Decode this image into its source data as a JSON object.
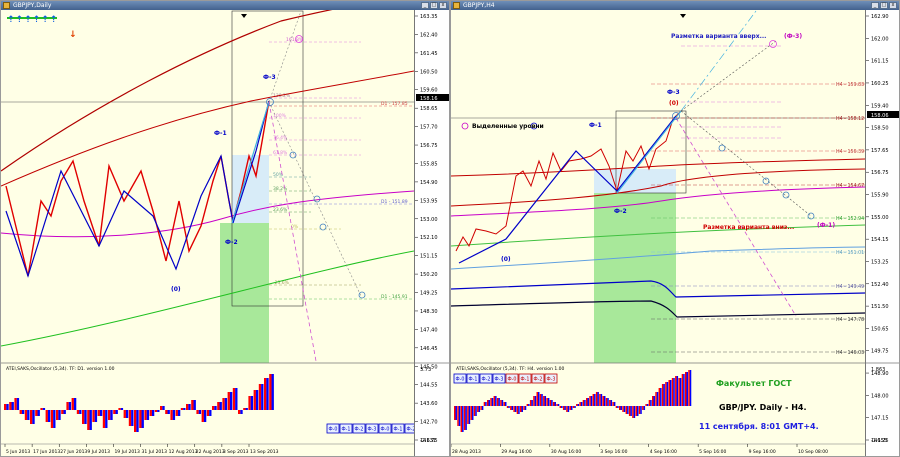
{
  "colors": {
    "chart_bg": "#ffffe6",
    "bull_line": "#0000c8",
    "bear_line": "#e00000",
    "accent_purple": "#c800c8",
    "green_zone": "#a8e89a",
    "osc_red": "#ff0000",
    "osc_blue": "#0000ff"
  },
  "left": {
    "title": "GBPJPY,Daily",
    "icons": [
      "arrow-up-icon",
      "arrow-up-icon",
      "arrow-up-icon",
      "arrow-up-icon",
      "arrow-up-icon",
      "arrow-up-icon"
    ],
    "red_arrow_icon": "arrow-down-icon",
    "price_labels": [
      "163.35",
      "162.40",
      "161.45",
      "160.50",
      "159.60",
      "158.65",
      "157.70",
      "156.75",
      "155.85",
      "154.90",
      "153.95",
      "153.00",
      "152.10",
      "151.15",
      "150.20",
      "149.25",
      "148.30",
      "147.40",
      "146.45",
      "145.50",
      "144.55",
      "143.60",
      "142.70",
      "141.75"
    ],
    "current_price_tag": "158.16",
    "osc_top": "3.73",
    "osc_bottom": "-2.631",
    "date_labels": [
      "5 Jun 2013",
      "17 Jun 2013",
      "27 Jun 2013",
      "9 Jul 2013",
      "19 Jul 2013",
      "31 Jul 2013",
      "12 Aug 2013",
      "22 Aug 2013",
      "3 Sep 2013",
      "13 Sep 2013"
    ],
    "osc_label": "ATEI,SAKS,Oscillator (5,34). TF: D1. version 1.00",
    "fib_labels": [
      "161.8%",
      "138.2%",
      "100%",
      "76.4%",
      "61.8%",
      "50%",
      "38.2%",
      "23.6%",
      "0%",
      "-23.6%"
    ],
    "level_tags": [
      "D1 - 157.85",
      "D1 - 151.89",
      "D1 - 145.91"
    ],
    "wave_labels": [
      "Ф-3",
      "Ф-1",
      "Ф-2",
      "(0)"
    ],
    "legend_buttons": [
      "Ф-0",
      "Ф-1",
      "Ф-2",
      "Ф-3",
      "Ф-0",
      "Ф-1",
      "Ф-2"
    ]
  },
  "right": {
    "title": "GBPJPY,H4",
    "price_labels": [
      "162.90",
      "162.00",
      "161.15",
      "160.25",
      "159.40",
      "158.50",
      "157.65",
      "156.75",
      "155.90",
      "155.00",
      "154.15",
      "153.25",
      "152.40",
      "151.50",
      "150.65",
      "149.75",
      "148.90",
      "148.00",
      "147.15",
      "146.25"
    ],
    "current_price_tag": "158.06",
    "osc_top": "1.863",
    "osc_bottom": "-1.155",
    "date_labels": [
      "28 Aug 2013",
      "29 Aug 16:00",
      "30 Aug 16:00",
      "3 Sep 16:00",
      "4 Sep 16:00",
      "5 Sep 16:00",
      "9 Sep 16:00",
      "10 Sep 08:00"
    ],
    "osc_label": "ATEI,SAKS,Oscillator (5,34). TF: H4. version 1.00",
    "level_tags": [
      "H4 - 159.83",
      "H4 - 158.12",
      "H4 - 156.39",
      "H4 - 154.67",
      "H4 - 152.94",
      "H4 - 151.01",
      "H4 - 149.49",
      "H4 - 147.78",
      "H4 - 146.03"
    ],
    "wave_labels": [
      "Ф-3",
      "(Ф-3)",
      "Ф-1",
      "Ф-2",
      "(0)",
      "(0)",
      "(Ф-1)"
    ],
    "annotation_up": "Разметка варианта вверх...",
    "annotation_down": "Разметка варианта вниз...",
    "legend_levels": "Выделенные уровни",
    "legend_buttons": [
      "Ф-0",
      "Ф-1",
      "Ф-2",
      "Ф-3",
      "Ф-0",
      "Ф-1",
      "Ф-2",
      "Ф-3"
    ],
    "school": "Факультет ГОСТ",
    "pair": "GBP/JPY. Daily - H4.",
    "date": "11 сентября. 8:01 GMT+4."
  }
}
